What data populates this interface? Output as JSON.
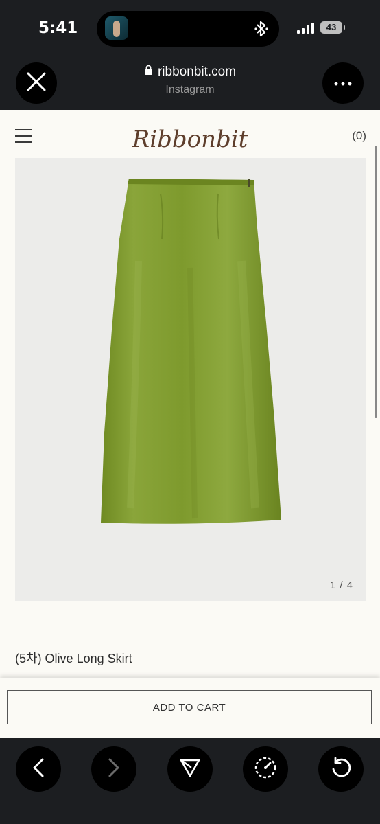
{
  "status_bar": {
    "time": "5:41",
    "battery": "43"
  },
  "browser": {
    "domain": "ribbonbit.com",
    "source": "Instagram"
  },
  "site": {
    "logo_text": "Ribbonbit",
    "cart_count": "(0)"
  },
  "product": {
    "image_counter": "1 / 4",
    "title": "(5차) Olive Long Skirt",
    "add_to_cart_label": "ADD TO CART",
    "skirt_color": "#7f9a2e"
  },
  "icons": [
    "close-icon",
    "more-icon",
    "lock-icon",
    "menu-icon",
    "back-icon",
    "forward-icon",
    "share-icon",
    "speed-icon",
    "reload-icon",
    "bluetooth-icon"
  ],
  "colors": {
    "page_bg": "#fbfaf5",
    "chrome_bg": "#1c1e21",
    "image_bg": "#ececea"
  }
}
